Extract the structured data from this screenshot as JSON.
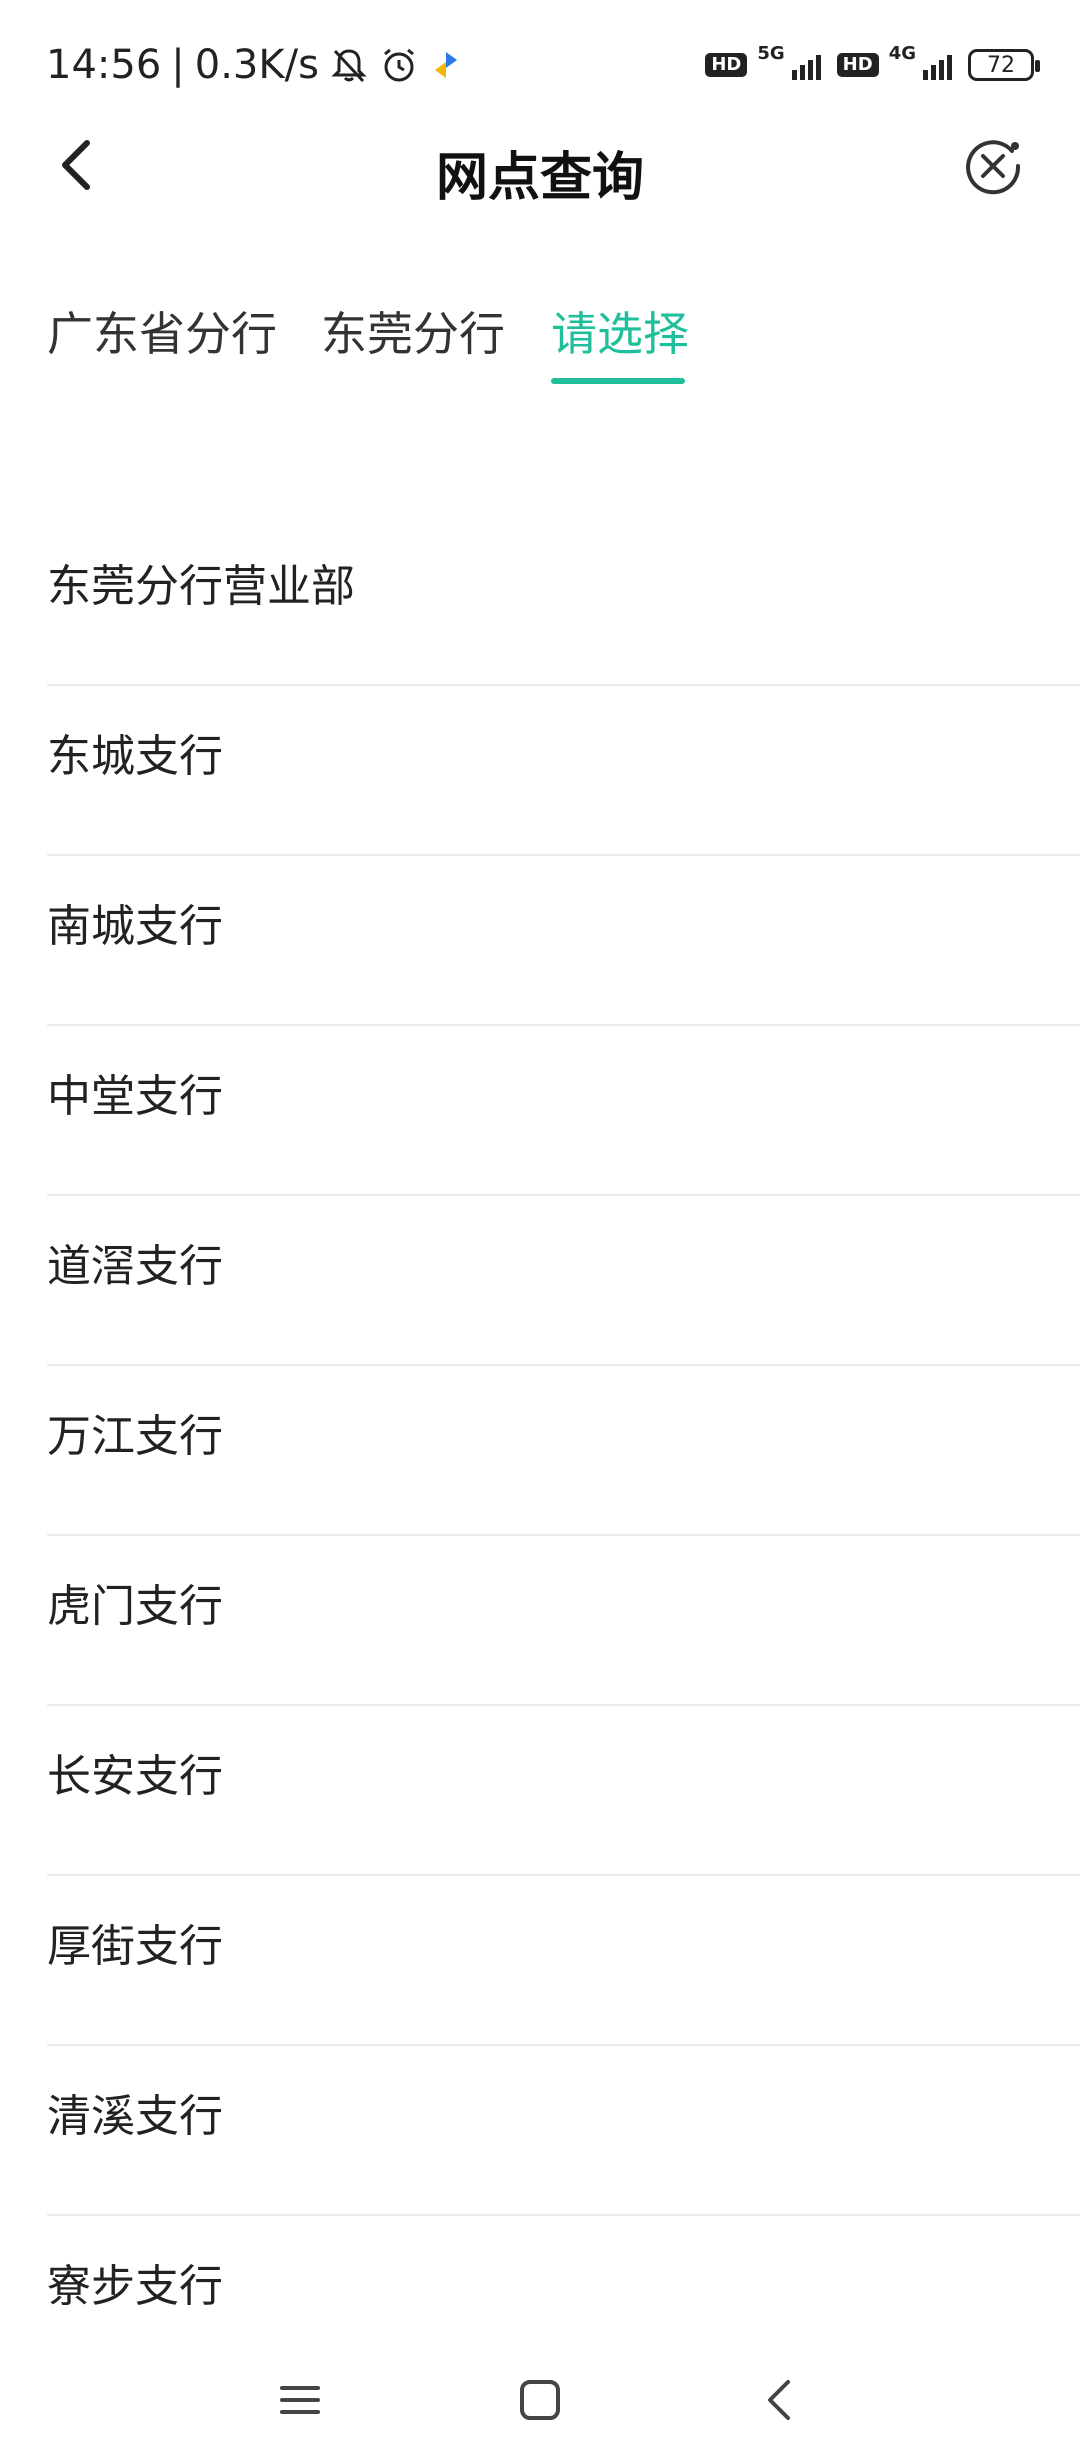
{
  "status_bar": {
    "time": "14:56",
    "separator": "|",
    "net_speed": "0.3K/s",
    "hd_label": "HD",
    "net1": "5G",
    "net2": "4G",
    "battery": "72"
  },
  "header": {
    "title": "网点查询"
  },
  "tabs": [
    {
      "label": "广东省分行",
      "active": false
    },
    {
      "label": "东莞分行",
      "active": false
    },
    {
      "label": "请选择",
      "active": true
    }
  ],
  "accent_color": "#1fbf9b",
  "branches": [
    "东莞分行营业部",
    "东城支行",
    "南城支行",
    "中堂支行",
    "道滘支行",
    "万江支行",
    "虎门支行",
    "长安支行",
    "厚街支行",
    "清溪支行",
    "寮步支行"
  ],
  "icons": {
    "back": "chevron-left-icon",
    "close": "close-circle-icon",
    "menu": "menu-icon",
    "home": "home-square-icon",
    "nav_back": "nav-back-icon"
  }
}
